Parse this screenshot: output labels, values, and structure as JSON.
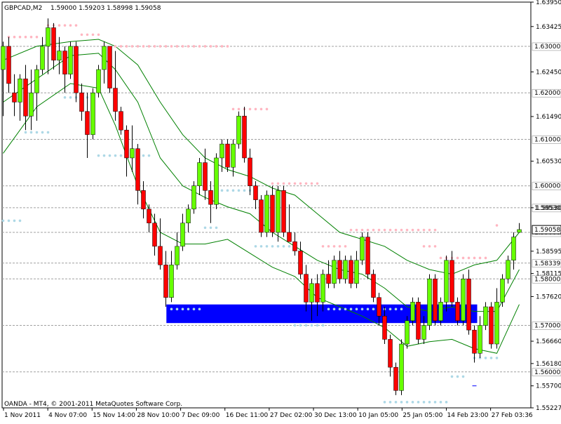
{
  "header": {
    "symbol": "GBPCAD,M2",
    "ohlc": "1.59000 1.59203 1.58998 1.59058"
  },
  "footer": {
    "copyright": "OANDA - MT4, © 2001-2011 MetaQuotes Software Corp."
  },
  "colors": {
    "bull": "#66ff00",
    "bear": "#ff0000",
    "envelope": "#008000",
    "zone": "#0000ff",
    "resist_dots": "#ffb6c1",
    "support_dots": "#add8e6",
    "grid": "#a0a0a0"
  },
  "chart_data": {
    "type": "candlestick",
    "ylim": [
      1.55227,
      1.6395
    ],
    "y_ticks": [
      "1.63950",
      "1.63425",
      "1.62450",
      "1.61490",
      "1.60530",
      "1.59530",
      "1.58595",
      "1.58115",
      "1.57620",
      "1.56660",
      "1.56180",
      "1.55700",
      "1.55227"
    ],
    "level_labels": [
      "1.63000",
      "1.62000",
      "1.61000",
      "1.60000",
      "1.59530",
      "1.59000",
      "1.58339",
      "1.58000",
      "1.57000",
      "1.56000"
    ],
    "current_price_label": "1.59058",
    "x_ticks": [
      "1 Nov 2011",
      "4 Nov 07:00",
      "15 Nov 14:00",
      "28 Nov 10:00",
      "7 Dec 09:00",
      "16 Dec 11:00",
      "27 Dec 02:00",
      "30 Dec 13:00",
      "10 Jan 05:00",
      "25 Jan 05:00",
      "14 Feb 23:00",
      "27 Feb 03:36"
    ],
    "candles": [
      {
        "o": 1.625,
        "h": 1.631,
        "l": 1.615,
        "c": 1.63
      },
      {
        "o": 1.63,
        "h": 1.632,
        "l": 1.62,
        "c": 1.622
      },
      {
        "o": 1.62,
        "h": 1.624,
        "l": 1.615,
        "c": 1.618
      },
      {
        "o": 1.618,
        "h": 1.624,
        "l": 1.614,
        "c": 1.623
      },
      {
        "o": 1.623,
        "h": 1.626,
        "l": 1.612,
        "c": 1.615
      },
      {
        "o": 1.615,
        "h": 1.625,
        "l": 1.612,
        "c": 1.62
      },
      {
        "o": 1.62,
        "h": 1.626,
        "l": 1.614,
        "c": 1.625
      },
      {
        "o": 1.625,
        "h": 1.632,
        "l": 1.624,
        "c": 1.63
      },
      {
        "o": 1.63,
        "h": 1.636,
        "l": 1.624,
        "c": 1.634
      },
      {
        "o": 1.634,
        "h": 1.635,
        "l": 1.625,
        "c": 1.627
      },
      {
        "o": 1.627,
        "h": 1.632,
        "l": 1.624,
        "c": 1.629
      },
      {
        "o": 1.629,
        "h": 1.63,
        "l": 1.62,
        "c": 1.624
      },
      {
        "o": 1.624,
        "h": 1.631,
        "l": 1.623,
        "c": 1.63
      },
      {
        "o": 1.63,
        "h": 1.631,
        "l": 1.618,
        "c": 1.62
      },
      {
        "o": 1.62,
        "h": 1.622,
        "l": 1.614,
        "c": 1.616
      },
      {
        "o": 1.616,
        "h": 1.62,
        "l": 1.606,
        "c": 1.611
      },
      {
        "o": 1.611,
        "h": 1.621,
        "l": 1.61,
        "c": 1.62
      },
      {
        "o": 1.62,
        "h": 1.626,
        "l": 1.619,
        "c": 1.625
      },
      {
        "o": 1.625,
        "h": 1.631,
        "l": 1.622,
        "c": 1.63
      },
      {
        "o": 1.63,
        "h": 1.63,
        "l": 1.62,
        "c": 1.621
      },
      {
        "o": 1.621,
        "h": 1.629,
        "l": 1.614,
        "c": 1.616
      },
      {
        "o": 1.616,
        "h": 1.617,
        "l": 1.611,
        "c": 1.612
      },
      {
        "o": 1.612,
        "h": 1.613,
        "l": 1.602,
        "c": 1.606
      },
      {
        "o": 1.606,
        "h": 1.613,
        "l": 1.603,
        "c": 1.608
      },
      {
        "o": 1.608,
        "h": 1.609,
        "l": 1.596,
        "c": 1.599
      },
      {
        "o": 1.599,
        "h": 1.601,
        "l": 1.593,
        "c": 1.595
      },
      {
        "o": 1.595,
        "h": 1.596,
        "l": 1.59,
        "c": 1.592
      },
      {
        "o": 1.592,
        "h": 1.594,
        "l": 1.585,
        "c": 1.587
      },
      {
        "o": 1.587,
        "h": 1.593,
        "l": 1.582,
        "c": 1.583
      },
      {
        "o": 1.583,
        "h": 1.586,
        "l": 1.574,
        "c": 1.576
      },
      {
        "o": 1.576,
        "h": 1.586,
        "l": 1.575,
        "c": 1.583
      },
      {
        "o": 1.583,
        "h": 1.59,
        "l": 1.582,
        "c": 1.587
      },
      {
        "o": 1.587,
        "h": 1.594,
        "l": 1.586,
        "c": 1.592
      },
      {
        "o": 1.592,
        "h": 1.596,
        "l": 1.59,
        "c": 1.595
      },
      {
        "o": 1.595,
        "h": 1.601,
        "l": 1.594,
        "c": 1.6
      },
      {
        "o": 1.6,
        "h": 1.606,
        "l": 1.598,
        "c": 1.605
      },
      {
        "o": 1.605,
        "h": 1.608,
        "l": 1.597,
        "c": 1.599
      },
      {
        "o": 1.599,
        "h": 1.601,
        "l": 1.592,
        "c": 1.596
      },
      {
        "o": 1.596,
        "h": 1.607,
        "l": 1.595,
        "c": 1.606
      },
      {
        "o": 1.606,
        "h": 1.61,
        "l": 1.603,
        "c": 1.609
      },
      {
        "o": 1.609,
        "h": 1.61,
        "l": 1.603,
        "c": 1.604
      },
      {
        "o": 1.604,
        "h": 1.61,
        "l": 1.602,
        "c": 1.609
      },
      {
        "o": 1.609,
        "h": 1.616,
        "l": 1.608,
        "c": 1.615
      },
      {
        "o": 1.615,
        "h": 1.617,
        "l": 1.605,
        "c": 1.606
      },
      {
        "o": 1.606,
        "h": 1.608,
        "l": 1.598,
        "c": 1.6
      },
      {
        "o": 1.6,
        "h": 1.601,
        "l": 1.595,
        "c": 1.597
      },
      {
        "o": 1.597,
        "h": 1.598,
        "l": 1.589,
        "c": 1.59
      },
      {
        "o": 1.59,
        "h": 1.599,
        "l": 1.589,
        "c": 1.598
      },
      {
        "o": 1.598,
        "h": 1.6,
        "l": 1.589,
        "c": 1.59
      },
      {
        "o": 1.59,
        "h": 1.6,
        "l": 1.588,
        "c": 1.599
      },
      {
        "o": 1.599,
        "h": 1.6,
        "l": 1.589,
        "c": 1.59
      },
      {
        "o": 1.59,
        "h": 1.596,
        "l": 1.588,
        "c": 1.588
      },
      {
        "o": 1.588,
        "h": 1.59,
        "l": 1.585,
        "c": 1.586
      },
      {
        "o": 1.586,
        "h": 1.588,
        "l": 1.58,
        "c": 1.581
      },
      {
        "o": 1.581,
        "h": 1.583,
        "l": 1.573,
        "c": 1.575
      },
      {
        "o": 1.575,
        "h": 1.58,
        "l": 1.571,
        "c": 1.579
      },
      {
        "o": 1.579,
        "h": 1.581,
        "l": 1.572,
        "c": 1.575
      },
      {
        "o": 1.575,
        "h": 1.582,
        "l": 1.573,
        "c": 1.581
      },
      {
        "o": 1.581,
        "h": 1.584,
        "l": 1.578,
        "c": 1.579
      },
      {
        "o": 1.579,
        "h": 1.585,
        "l": 1.578,
        "c": 1.584
      },
      {
        "o": 1.584,
        "h": 1.586,
        "l": 1.579,
        "c": 1.58
      },
      {
        "o": 1.58,
        "h": 1.585,
        "l": 1.579,
        "c": 1.584
      },
      {
        "o": 1.584,
        "h": 1.585,
        "l": 1.578,
        "c": 1.579
      },
      {
        "o": 1.579,
        "h": 1.586,
        "l": 1.578,
        "c": 1.584
      },
      {
        "o": 1.584,
        "h": 1.59,
        "l": 1.583,
        "c": 1.589
      },
      {
        "o": 1.589,
        "h": 1.59,
        "l": 1.58,
        "c": 1.581
      },
      {
        "o": 1.581,
        "h": 1.582,
        "l": 1.575,
        "c": 1.576
      },
      {
        "o": 1.576,
        "h": 1.577,
        "l": 1.57,
        "c": 1.572
      },
      {
        "o": 1.572,
        "h": 1.574,
        "l": 1.566,
        "c": 1.567
      },
      {
        "o": 1.567,
        "h": 1.568,
        "l": 1.559,
        "c": 1.561
      },
      {
        "o": 1.561,
        "h": 1.562,
        "l": 1.555,
        "c": 1.556
      },
      {
        "o": 1.556,
        "h": 1.567,
        "l": 1.555,
        "c": 1.566
      },
      {
        "o": 1.566,
        "h": 1.572,
        "l": 1.565,
        "c": 1.571
      },
      {
        "o": 1.571,
        "h": 1.576,
        "l": 1.57,
        "c": 1.575
      },
      {
        "o": 1.575,
        "h": 1.576,
        "l": 1.566,
        "c": 1.567
      },
      {
        "o": 1.567,
        "h": 1.572,
        "l": 1.566,
        "c": 1.57
      },
      {
        "o": 1.57,
        "h": 1.581,
        "l": 1.569,
        "c": 1.58
      },
      {
        "o": 1.58,
        "h": 1.581,
        "l": 1.57,
        "c": 1.571
      },
      {
        "o": 1.571,
        "h": 1.576,
        "l": 1.57,
        "c": 1.575
      },
      {
        "o": 1.575,
        "h": 1.585,
        "l": 1.573,
        "c": 1.584
      },
      {
        "o": 1.584,
        "h": 1.586,
        "l": 1.574,
        "c": 1.575
      },
      {
        "o": 1.575,
        "h": 1.576,
        "l": 1.57,
        "c": 1.571
      },
      {
        "o": 1.571,
        "h": 1.581,
        "l": 1.57,
        "c": 1.58
      },
      {
        "o": 1.58,
        "h": 1.582,
        "l": 1.568,
        "c": 1.569
      },
      {
        "o": 1.569,
        "h": 1.57,
        "l": 1.562,
        "c": 1.564
      },
      {
        "o": 1.564,
        "h": 1.572,
        "l": 1.563,
        "c": 1.57
      },
      {
        "o": 1.57,
        "h": 1.575,
        "l": 1.569,
        "c": 1.574
      },
      {
        "o": 1.574,
        "h": 1.575,
        "l": 1.565,
        "c": 1.566
      },
      {
        "o": 1.566,
        "h": 1.578,
        "l": 1.565,
        "c": 1.575
      },
      {
        "o": 1.575,
        "h": 1.581,
        "l": 1.574,
        "c": 1.58
      },
      {
        "o": 1.58,
        "h": 1.585,
        "l": 1.579,
        "c": 1.584
      },
      {
        "o": 1.584,
        "h": 1.59,
        "l": 1.582,
        "c": 1.589
      },
      {
        "o": 1.59,
        "h": 1.592,
        "l": 1.5899,
        "c": 1.5906
      }
    ],
    "envelope_mid": [
      [
        0,
        1.618
      ],
      [
        6,
        1.623
      ],
      [
        12,
        1.628
      ],
      [
        17,
        1.6285
      ],
      [
        20,
        1.625
      ],
      [
        24,
        1.618
      ],
      [
        28,
        1.606
      ],
      [
        32,
        1.6
      ],
      [
        36,
        1.5975
      ],
      [
        40,
        1.5955
      ],
      [
        44,
        1.594
      ],
      [
        48,
        1.59
      ],
      [
        52,
        1.587
      ],
      [
        56,
        1.584
      ],
      [
        60,
        1.582
      ],
      [
        64,
        1.581
      ],
      [
        68,
        1.578
      ],
      [
        72,
        1.574
      ],
      [
        76,
        1.573
      ],
      [
        80,
        1.574
      ],
      [
        84,
        1.573
      ],
      [
        88,
        1.573
      ],
      [
        92,
        1.582
      ]
    ],
    "envelope_upper": [
      [
        0,
        1.627
      ],
      [
        6,
        1.63
      ],
      [
        12,
        1.631
      ],
      [
        17,
        1.6315
      ],
      [
        20,
        1.63
      ],
      [
        24,
        1.626
      ],
      [
        28,
        1.618
      ],
      [
        32,
        1.611
      ],
      [
        36,
        1.606
      ],
      [
        40,
        1.6035
      ],
      [
        44,
        1.602
      ],
      [
        48,
        1.5995
      ],
      [
        52,
        1.598
      ],
      [
        56,
        1.594
      ],
      [
        60,
        1.59
      ],
      [
        64,
        1.5885
      ],
      [
        68,
        1.587
      ],
      [
        72,
        1.584
      ],
      [
        76,
        1.582
      ],
      [
        80,
        1.581
      ],
      [
        84,
        1.583
      ],
      [
        88,
        1.584
      ],
      [
        92,
        1.59
      ]
    ],
    "envelope_lower": [
      [
        0,
        1.607
      ],
      [
        6,
        1.617
      ],
      [
        12,
        1.622
      ],
      [
        17,
        1.621
      ],
      [
        20,
        1.613
      ],
      [
        24,
        1.6
      ],
      [
        28,
        1.59
      ],
      [
        32,
        1.5875
      ],
      [
        36,
        1.5875
      ],
      [
        40,
        1.5885
      ],
      [
        44,
        1.5855
      ],
      [
        48,
        1.5825
      ],
      [
        52,
        1.5805
      ],
      [
        56,
        1.576
      ],
      [
        60,
        1.574
      ],
      [
        64,
        1.572
      ],
      [
        68,
        1.5695
      ],
      [
        72,
        1.5655
      ],
      [
        76,
        1.5665
      ],
      [
        80,
        1.567
      ],
      [
        84,
        1.565
      ],
      [
        88,
        1.564
      ],
      [
        92,
        1.5745
      ]
    ],
    "resistance_dots": [
      {
        "x0": 1,
        "x1": 6,
        "y": 1.632
      },
      {
        "x0": 8,
        "x1": 13,
        "y": 1.6345
      },
      {
        "x0": 14,
        "x1": 17,
        "y": 1.6325
      },
      {
        "x0": 20,
        "x1": 40,
        "y": 1.63
      },
      {
        "x0": 41,
        "x1": 47,
        "y": 1.6165
      },
      {
        "x0": 48,
        "x1": 56,
        "y": 1.6005
      },
      {
        "x0": 57,
        "x1": 61,
        "y": 1.587
      },
      {
        "x0": 62,
        "x1": 77,
        "y": 1.5905
      },
      {
        "x0": 75,
        "x1": 77,
        "y": 1.587
      },
      {
        "x0": 78,
        "x1": 86,
        "y": 1.5845
      },
      {
        "x0": 88,
        "x1": 88,
        "y": 1.5915
      }
    ],
    "support_dots": [
      {
        "x0": 0,
        "x1": 3,
        "y": 1.5925
      },
      {
        "x0": 4,
        "x1": 8,
        "y": 1.6115
      },
      {
        "x0": 11,
        "x1": 15,
        "y": 1.619
      },
      {
        "x0": 17,
        "x1": 26,
        "y": 1.6065
      },
      {
        "x0": 30,
        "x1": 35,
        "y": 1.5735
      },
      {
        "x0": 36,
        "x1": 38,
        "y": 1.591
      },
      {
        "x0": 39,
        "x1": 44,
        "y": 1.599
      },
      {
        "x0": 45,
        "x1": 51,
        "y": 1.587
      },
      {
        "x0": 52,
        "x1": 57,
        "y": 1.57
      },
      {
        "x0": 58,
        "x1": 71,
        "y": 1.5735
      },
      {
        "x0": 68,
        "x1": 79,
        "y": 1.5535
      },
      {
        "x0": 80,
        "x1": 82,
        "y": 1.559
      },
      {
        "x0": 84,
        "x1": 88,
        "y": 1.563
      }
    ],
    "zone": {
      "x0": 29.1,
      "x1": 84.5,
      "y_top": 1.5745,
      "y_bottom": 1.5705
    },
    "small_marker": {
      "x": 84,
      "y": 1.557
    }
  }
}
